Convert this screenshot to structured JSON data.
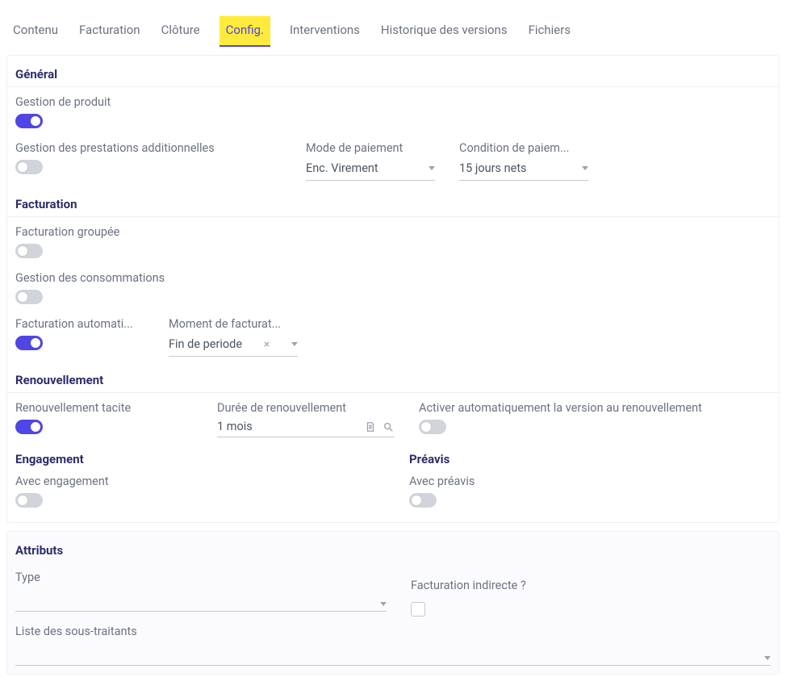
{
  "tabs": {
    "contenu": "Contenu",
    "facturation": "Facturation",
    "cloture": "Clôture",
    "config": "Config.",
    "interventions": "Interventions",
    "historique": "Historique des versions",
    "fichiers": "Fichiers"
  },
  "sections": {
    "general": "Général",
    "facturation": "Facturation",
    "renouvellement": "Renouvellement",
    "engagement": "Engagement",
    "preavis": "Préavis",
    "attributs": "Attributs"
  },
  "fields": {
    "gestion_produit": "Gestion de produit",
    "gestion_prestations": "Gestion des prestations additionnelles",
    "mode_paiement": "Mode de paiement",
    "mode_paiement_val": "Enc. Virement",
    "condition_paiement": "Condition de paiem...",
    "condition_paiement_val": "15 jours nets",
    "facturation_groupee": "Facturation groupée",
    "gestion_consommations": "Gestion des consommations",
    "facturation_auto": "Facturation automati...",
    "moment_facturation": "Moment de facturat...",
    "moment_facturation_val": "Fin de periode",
    "renouvellement_tacite": "Renouvellement tacite",
    "duree_renouvellement": "Durée de renouvellement",
    "duree_renouvellement_val": "1 mois",
    "activer_auto_version": "Activer automatiquement la version au renouvellement",
    "avec_engagement": "Avec engagement",
    "avec_preavis": "Avec préavis",
    "type": "Type",
    "facturation_indirecte": "Facturation indirecte ?",
    "liste_sous_traitants": "Liste des sous-traitants"
  },
  "toggles": {
    "gestion_produit": true,
    "gestion_prestations": false,
    "facturation_groupee": false,
    "gestion_consommations": false,
    "facturation_auto": true,
    "renouvellement_tacite": true,
    "activer_auto_version": false,
    "avec_engagement": false,
    "avec_preavis": false
  }
}
